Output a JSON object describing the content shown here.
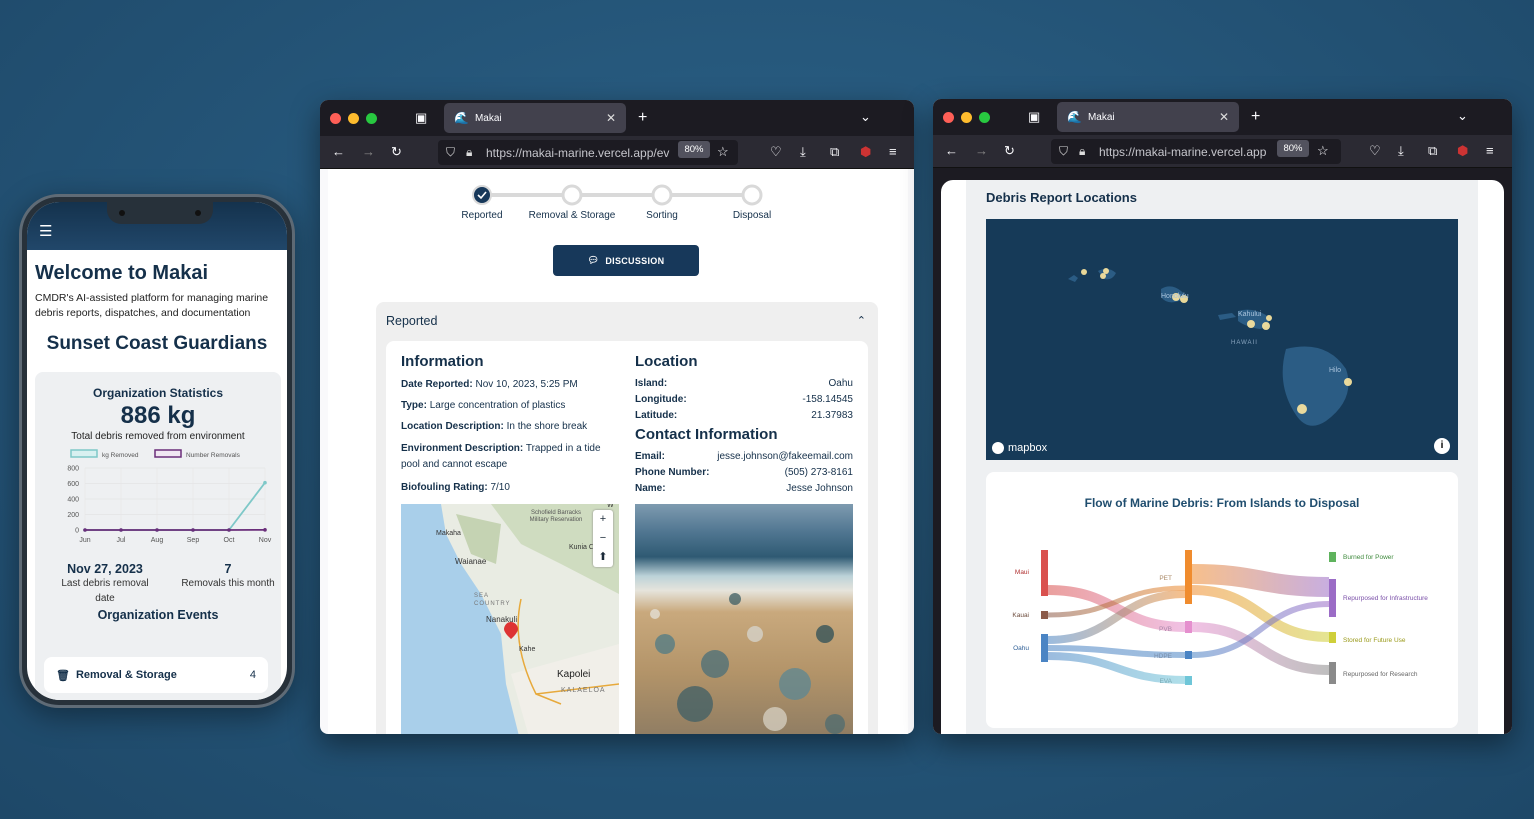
{
  "phone": {
    "title": "Welcome to Makai",
    "subtitle": "CMDR's AI-assisted platform for managing marine debris reports, dispatches, and documentation",
    "org_name": "Sunset Coast Guardians",
    "stats_title": "Organization Statistics",
    "total_kg": "886 kg",
    "total_label": "Total debris removed from environment",
    "last_date": "Nov 27, 2023",
    "last_date_label": "Last debris removal date",
    "removals": "7",
    "removals_label": "Removals this month",
    "events_title": "Organization Events",
    "event_label": "Removal & Storage",
    "event_count": "4"
  },
  "chart_data": {
    "type": "line",
    "categories": [
      "Jun",
      "Jul",
      "Aug",
      "Sep",
      "Oct",
      "Nov"
    ],
    "series": [
      {
        "name": "kg Removed",
        "values": [
          0,
          0,
          0,
          0,
          0,
          610
        ],
        "color": "#7ec8c8"
      },
      {
        "name": "Number Removals",
        "values": [
          0,
          0,
          0,
          0,
          0,
          2
        ],
        "color": "#6a2e7a"
      }
    ],
    "yticks": [
      0,
      200,
      400,
      600,
      800
    ],
    "ylim": [
      0,
      800
    ],
    "legend": "top"
  },
  "browser": {
    "tab_title": "Makai",
    "url_left": "https://makai-marine.vercel.app/ev",
    "url_right": "https://makai-marine.vercel.app",
    "zoom": "80%"
  },
  "report": {
    "steps": [
      "Reported",
      "Removal & Storage",
      "Sorting",
      "Disposal"
    ],
    "discussion": "DISCUSSION",
    "section": "Reported",
    "info_title": "Information",
    "date_label": "Date Reported:",
    "date_value": "Nov 10, 2023, 5:25 PM",
    "type_label": "Type:",
    "type_value": "Large concentration of plastics",
    "locdesc_label": "Location Description:",
    "locdesc_value": "In the shore break",
    "env_label": "Environment Description:",
    "env_value": "Trapped in a tide pool and cannot escape",
    "bio_label": "Biofouling Rating:",
    "bio_value": "7/10",
    "loc_title": "Location",
    "island_label": "Island:",
    "island_value": "Oahu",
    "lon_label": "Longitude:",
    "lon_value": "-158.14545",
    "lat_label": "Latitude:",
    "lat_value": "21.37983",
    "contact_title": "Contact Information",
    "email_label": "Email:",
    "email_value": "jesse.johnson@fakeemail.com",
    "phone_label": "Phone Number:",
    "phone_value": "(505) 273-8161",
    "name_label": "Name:",
    "name_value": "Jesse Johnson",
    "map_labels": {
      "makaha": "Makaha",
      "waianae": "Waianae",
      "schofield": "Schofield Barracks Military Reservation",
      "kunia": "Kunia C",
      "sea": "SEA COUNTRY",
      "nanakuli": "Nanakuli",
      "kahe": "Kahe",
      "kapolei": "Kapolei",
      "kalaeloa": "KALAELOA",
      "w": "W"
    }
  },
  "locations": {
    "title": "Debris Report Locations",
    "mapbox": "mapbox",
    "map_labels": {
      "honolulu": "Honolulu",
      "kahului": "Kahului",
      "hawaii": "HAWAII",
      "hilo": "Hilo"
    }
  },
  "sankey": {
    "title": "Flow of Marine Debris: From Islands to Disposal",
    "sources": [
      "Maui",
      "Kauai",
      "Oahu"
    ],
    "materials": [
      "PET",
      "PVB",
      "HDPE",
      "EVA"
    ],
    "destinations": [
      "Burned for Power",
      "Repurposed for Infrastructure",
      "Stored for Future Use",
      "Repurposed for Research"
    ],
    "colors": {
      "maui": "#d9514e",
      "kauai": "#8c5b4a",
      "oahu": "#4a84c4",
      "pet": "#f08c2e",
      "pvb": "#e58fce",
      "hdpe": "#4a84c4",
      "eva": "#6fc6d8",
      "burned": "#5fb35d",
      "infra": "#9b6cc6",
      "stored": "#cfcf3a",
      "research": "#8a8a8a"
    }
  }
}
